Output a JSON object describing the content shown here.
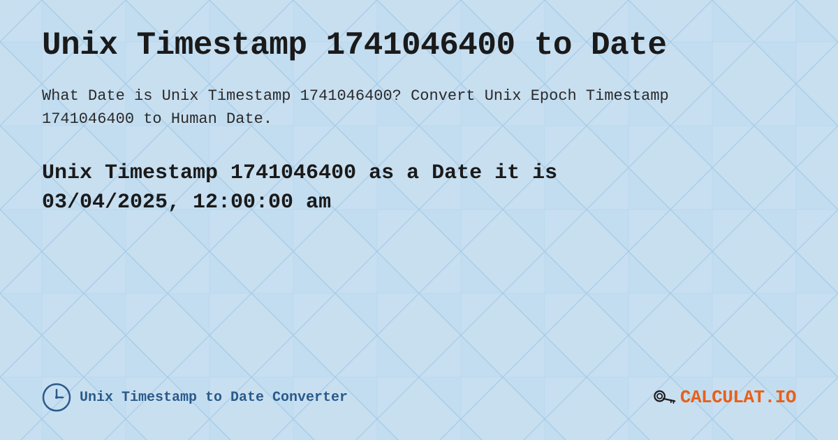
{
  "page": {
    "title": "Unix Timestamp 1741046400 to Date",
    "description": "What Date is Unix Timestamp 1741046400? Convert Unix Epoch Timestamp 1741046400 to Human Date.",
    "result_line1": "Unix Timestamp 1741046400 as a Date it is",
    "result_line2": "03/04/2025, 12:00:00 am",
    "footer_link": "Unix Timestamp to Date Converter",
    "logo_text_part1": "CALCULAT",
    "logo_text_dot": ".",
    "logo_text_part2": "IO"
  },
  "colors": {
    "background": "#c8dff0",
    "title": "#1a1a1a",
    "description": "#2a2a2a",
    "result": "#1a1a1a",
    "link": "#2a5a8a",
    "logo_accent": "#e8601a"
  }
}
